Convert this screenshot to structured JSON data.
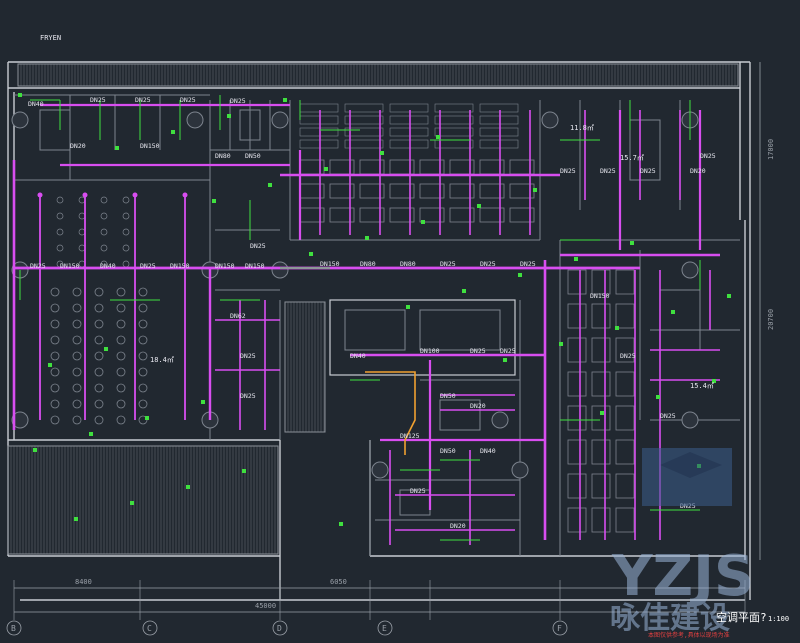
{
  "colors": {
    "background": "#212830",
    "wall": "#c8ccd2",
    "wall_dim": "#7d848e",
    "pipe_main": "#d84ef0",
    "pipe_branch": "#c020e0",
    "leader": "#3fe03f",
    "label": "#e8e8f0",
    "dimension": "#9aa0a8",
    "hatch": "#8a9098",
    "highlight": "#f0a030",
    "watermark": "#9ab4d8"
  },
  "drawing": {
    "top_tag": "FRYEN",
    "caption": "空调平面?",
    "scale": "1:100",
    "footer_note": "本图仅供参考,具体以现场为准",
    "pipe_labels": [
      "DN40",
      "DN25",
      "DN25",
      "DN25",
      "DN20",
      "DN150",
      "DN25",
      "DN80",
      "DN50",
      "DN40",
      "DN25",
      "DN25",
      "DN150",
      "DN150",
      "DN150",
      "DN150",
      "DN150",
      "DN80",
      "DN80",
      "DN25",
      "DN25",
      "DN25",
      "DN25",
      "DN25",
      "DN25",
      "DN20",
      "DN62",
      "DN25",
      "DN25",
      "DN25",
      "DN40",
      "DN100",
      "DN25",
      "DN25",
      "DN50",
      "DN20",
      "DN125",
      "DN50",
      "DN40",
      "DN25",
      "DN20",
      "DN150",
      "DN25",
      "DN25",
      "DN25",
      "DN25"
    ],
    "room_labels": [
      "11.8㎡",
      "15.4㎡",
      "18.4㎡",
      "15.7㎡"
    ],
    "dimensions": [
      "8400",
      "45000",
      "6050",
      "20700",
      "17000"
    ],
    "grid_labels": [
      "B",
      "C",
      "D",
      "E",
      "F"
    ]
  },
  "watermark": {
    "brand": "YZJS",
    "chinese": "咏佳建设"
  }
}
